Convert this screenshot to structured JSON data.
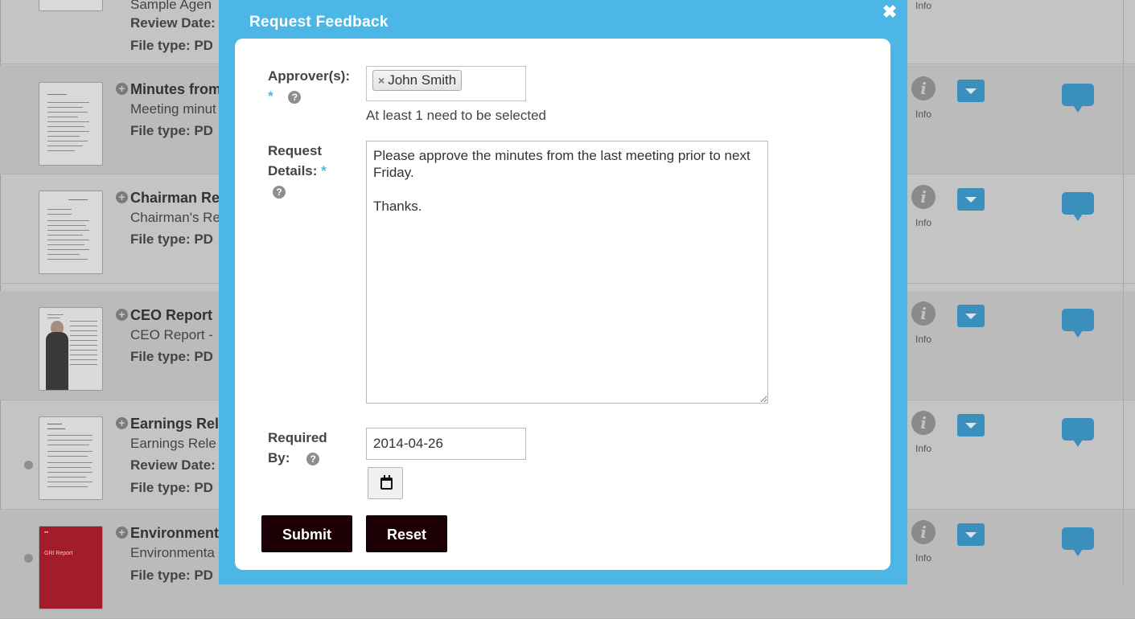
{
  "background": {
    "top_partial": {
      "title": "Sample Agen",
      "review_label": "Review Date:",
      "file_type_label": "File type: PD",
      "info_label": "Info"
    },
    "rows": [
      {
        "title": "Minutes from",
        "subtitle": "Meeting minut",
        "file_type_label": "File type: PD",
        "info_label": "Info"
      },
      {
        "title": "Chairman Re",
        "subtitle": "Chairman's Re",
        "file_type_label": "File type: PD",
        "info_label": "Info"
      },
      {
        "title": "CEO Report",
        "subtitle": "CEO Report -",
        "file_type_label": "File type: PD",
        "info_label": "Info"
      },
      {
        "title": "Earnings Rel",
        "subtitle": "Earnings Rele",
        "review_label": "Review Date:",
        "file_type_label": "File type: PD",
        "info_label": "Info"
      },
      {
        "title": "Environment",
        "subtitle": "Environmenta",
        "file_type_label": "File type: PD",
        "info_label": "Info",
        "thumb_text": "GRI Report"
      }
    ],
    "thumb_brand": "intelligence",
    "plus_icon": "plus-circle-icon",
    "info_icon": "info-icon",
    "dropdown_icon": "caret-down-icon",
    "comment_icon": "speech-bubble-icon",
    "colors": {
      "accent_blue": "#3b8fbd",
      "overlay": "#c4c4c4"
    }
  },
  "modal": {
    "title": "Request Feedback",
    "close_glyph": "✖",
    "approvers": {
      "label": "Approver(s):",
      "required_mark": "*",
      "help_glyph": "?",
      "selected": [
        "John Smith"
      ],
      "remove_glyph": "×",
      "hint": "At least 1 need to be selected"
    },
    "details": {
      "label_line1": "Request",
      "label_line2": "Details:",
      "required_mark": "*",
      "help_glyph": "?",
      "value": "Please approve the minutes from the last meeting prior to next Friday.\n\nThanks."
    },
    "required_by": {
      "label_line1": "Required",
      "label_line2": "By:",
      "help_glyph": "?",
      "value": "2014-04-26",
      "calendar_icon": "calendar-icon"
    },
    "buttons": {
      "submit": "Submit",
      "reset": "Reset"
    },
    "colors": {
      "header": "#4cb6e6",
      "button": "#1d0005",
      "required": "#4cb6e6"
    }
  }
}
